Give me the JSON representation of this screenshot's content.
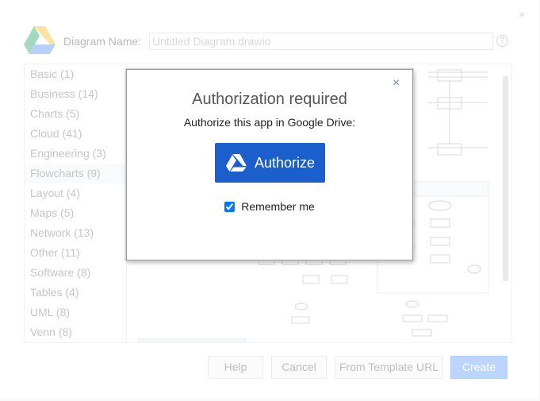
{
  "background_dialog": {
    "diagram_name_label": "Diagram Name:",
    "diagram_name_value": "Untitled Diagram.drawio",
    "help_icon_glyph": "?",
    "close_glyph": "×",
    "categories": [
      {
        "label": "Basic (1)"
      },
      {
        "label": "Business (14)"
      },
      {
        "label": "Charts (5)"
      },
      {
        "label": "Cloud (41)"
      },
      {
        "label": "Engineering (3)"
      },
      {
        "label": "Flowcharts (9)",
        "selected": true
      },
      {
        "label": "Layout (4)"
      },
      {
        "label": "Maps (5)"
      },
      {
        "label": "Network (13)"
      },
      {
        "label": "Other (11)"
      },
      {
        "label": "Software (8)"
      },
      {
        "label": "Tables (4)"
      },
      {
        "label": "UML (8)"
      },
      {
        "label": "Venn (8)"
      }
    ],
    "buttons": {
      "help": "Help",
      "cancel": "Cancel",
      "from_template_url": "From Template URL",
      "create": "Create"
    }
  },
  "modal": {
    "title": "Authorization required",
    "subtitle": "Authorize this app in Google Drive:",
    "authorize_label": "Authorize",
    "remember_label": "Remember me",
    "remember_checked": true,
    "close_glyph": "×"
  },
  "colors": {
    "authorize_button": "#1a5fcc",
    "create_button": "#4d90fe",
    "drive_green": "#0f9d58",
    "drive_yellow": "#f4b400",
    "drive_blue": "#4285f4"
  },
  "icons": [
    "google-drive-icon",
    "help-icon",
    "close-icon",
    "checkbox-icon"
  ]
}
